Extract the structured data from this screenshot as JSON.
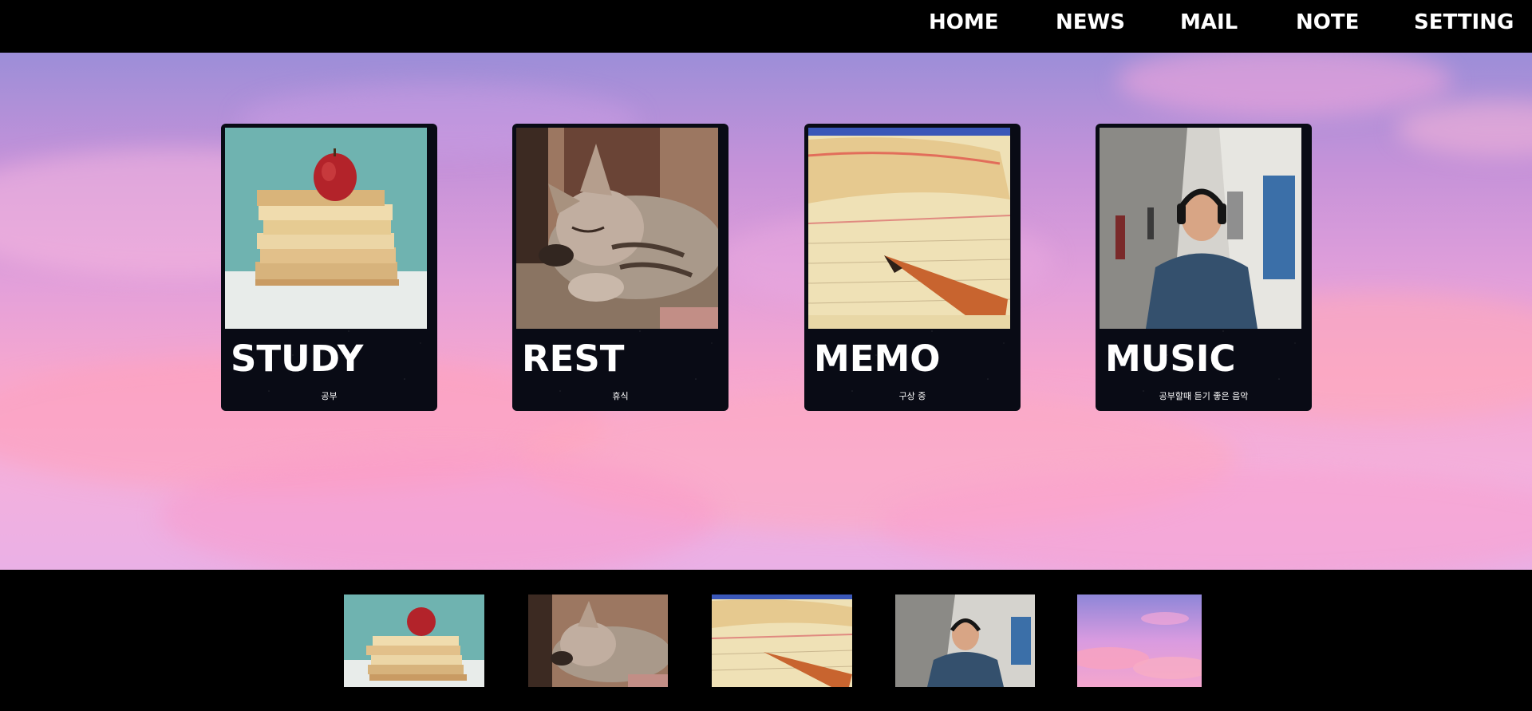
{
  "nav": {
    "items": [
      {
        "label": "HOME"
      },
      {
        "label": "NEWS"
      },
      {
        "label": "MAIL"
      },
      {
        "label": "NOTE"
      },
      {
        "label": "SETTING"
      }
    ]
  },
  "hero": {
    "background": "pink-purple sunset sky with clouds"
  },
  "cards": [
    {
      "title": "STUDY",
      "subtitle": "공부",
      "image": "apple-on-books"
    },
    {
      "title": "REST",
      "subtitle": "휴식",
      "image": "sleeping-kitten"
    },
    {
      "title": "MEMO",
      "subtitle": "구상 중",
      "image": "pencil-on-notepad"
    },
    {
      "title": "MUSIC",
      "subtitle": "공부할때 듣기 좋은 음악",
      "image": "man-with-headphones"
    }
  ],
  "thumbnails": [
    {
      "image": "apple-on-books"
    },
    {
      "image": "sleeping-kitten"
    },
    {
      "image": "pencil-on-notepad"
    },
    {
      "image": "man-with-headphones"
    },
    {
      "image": "sunset-sky"
    }
  ],
  "colors": {
    "nav_background": "#000000",
    "nav_text": "#ffffff",
    "card_background": "#090b15",
    "footer_background": "#000000"
  }
}
